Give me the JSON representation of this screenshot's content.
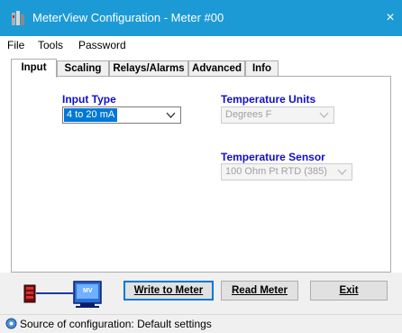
{
  "window": {
    "title": "MeterView Configuration - Meter #00",
    "close_glyph": "×",
    "titlebar_color": "#1c9ad6"
  },
  "menu": [
    {
      "label": "File"
    },
    {
      "label": "Tools"
    },
    {
      "label": "Password"
    }
  ],
  "tabs": [
    {
      "label": "Input",
      "active": true
    },
    {
      "label": "Scaling"
    },
    {
      "label": "Relays/Alarms"
    },
    {
      "label": "Advanced"
    },
    {
      "label": "Info"
    }
  ],
  "input_panel": {
    "input_type": {
      "label": "Input Type",
      "value": "4 to 20 mA"
    },
    "temperature_units": {
      "label": "Temperature Units",
      "value": "Degrees F",
      "enabled": false
    },
    "temperature_sensor": {
      "label": "Temperature Sensor",
      "value": "100 Ohm Pt RTD (385)",
      "enabled": false
    }
  },
  "connection_graphic": {
    "meter_icon": "red-meter-icon",
    "link_icon": "connection-line-icon",
    "computer_icon": "computer-mv3-icon",
    "computer_label": "MV"
  },
  "buttons": {
    "write": "Write to Meter",
    "read": "Read Meter",
    "exit": "Exit"
  },
  "status": {
    "icon": "info-gear-icon",
    "text": "Source of configuration: Default settings"
  },
  "colors": {
    "label_blue": "#1010c8",
    "selection": "#0078d7",
    "button_focus": "#0078d7"
  }
}
